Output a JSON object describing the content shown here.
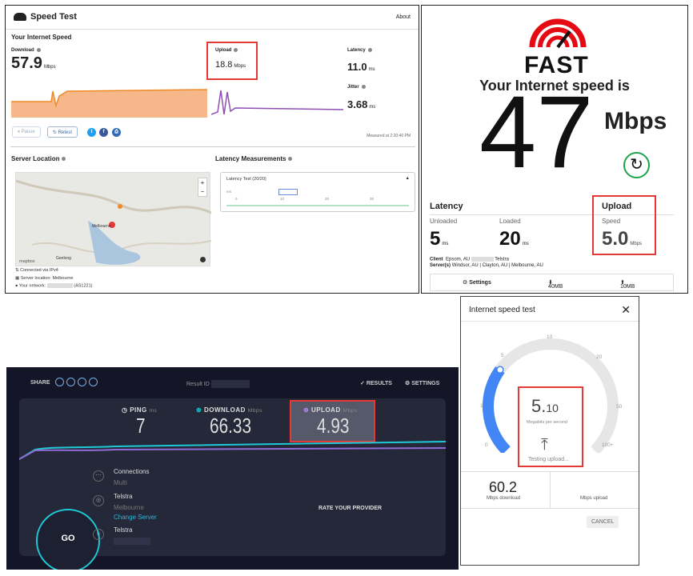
{
  "panel_a": {
    "app_title": "Speed Test",
    "about": "About",
    "section_title": "Your Internet Speed",
    "download_label": "Download",
    "download_value": "57.9",
    "download_unit": "Mbps",
    "upload_label": "Upload",
    "upload_value": "18.8",
    "upload_unit": "Mbps",
    "latency_label": "Latency",
    "latency_value": "11.0",
    "latency_unit": "ms",
    "jitter_label": "Jitter",
    "jitter_value": "3.68",
    "jitter_unit": "ms",
    "pause_label": "Pause",
    "retest_label": "Retest",
    "measured_at": "Measured at 2:20:40 PM",
    "server_location_title": "Server Location",
    "latency_measurements_title": "Latency Measurements",
    "latency_test_label": "Latency Test (20/20)",
    "latency_axis": [
      "ms",
      "0",
      "10",
      "20",
      "30"
    ],
    "map_attribution": "mapbox",
    "connected_via": "Connected via IPv4",
    "server_location": "Server location: Melbourne",
    "your_network": "Your network:",
    "your_network_asn": "(AS1221)",
    "map_labels": [
      "Melbourne",
      "Geelong"
    ],
    "colors": {
      "download": "#f08a24",
      "upload": "#8e4fb5",
      "redbox": "#e53935"
    }
  },
  "panel_b": {
    "logo_text": "FAST",
    "headline": "Your Internet speed is",
    "speed_value": "47",
    "speed_unit": "Mbps",
    "latency_title": "Latency",
    "unloaded_label": "Unloaded",
    "unloaded_value": "5",
    "loaded_label": "Loaded",
    "loaded_value": "20",
    "latency_unit": "ms",
    "upload_title": "Upload",
    "upload_sub": "Speed",
    "upload_value": "5.0",
    "upload_unit": "Mbps",
    "client_label": "Client",
    "client_value": "Epsom, AU",
    "client_isp": "Telstra",
    "servers_label": "Server(s)",
    "servers_value": "Windsor, AU | Clayton, AU | Melbourne, AU",
    "settings_label": "Settings",
    "opt1": "40MB",
    "opt2": "10MB",
    "colors": {
      "logo_red": "#e50914",
      "reload": "#1fa34a"
    }
  },
  "panel_c": {
    "share_label": "SHARE",
    "result_id_label": "Result ID",
    "results_label": "RESULTS",
    "settings_label": "SETTINGS",
    "ping_label": "PING",
    "ping_unit": "ms",
    "ping_value": "7",
    "download_label": "DOWNLOAD",
    "download_unit": "Mbps",
    "download_value": "66.33",
    "upload_label": "UPLOAD",
    "upload_unit": "Mbps",
    "upload_value": "4.93",
    "go_label": "GO",
    "connections_label": "Connections",
    "connections_value": "Multi",
    "isp_label": "Telstra",
    "server_city": "Melbourne",
    "change_server": "Change Server",
    "user_isp": "Telstra",
    "rate_provider": "RATE YOUR PROVIDER",
    "colors": {
      "bg": "#141526",
      "card": "#252838",
      "accent": "#1fc9d6",
      "upload_line": "#8e6bd6"
    }
  },
  "panel_d": {
    "title": "Internet speed test",
    "close": "✕",
    "gauge_ticks": [
      "0",
      "1",
      "5",
      "10",
      "20",
      "50",
      "100+"
    ],
    "gauge_value_main": "5.",
    "gauge_value_decimals": "10",
    "gauge_unit": "Megabits per second",
    "gauge_level": 0.3,
    "testing_label": "Testing upload...",
    "download_value": "60.2",
    "download_caption": "Mbps download",
    "upload_caption": "Mbps upload",
    "cancel_label": "CANCEL",
    "colors": {
      "gauge_fill": "#4285f4",
      "gauge_track": "#e6e6e6"
    }
  }
}
